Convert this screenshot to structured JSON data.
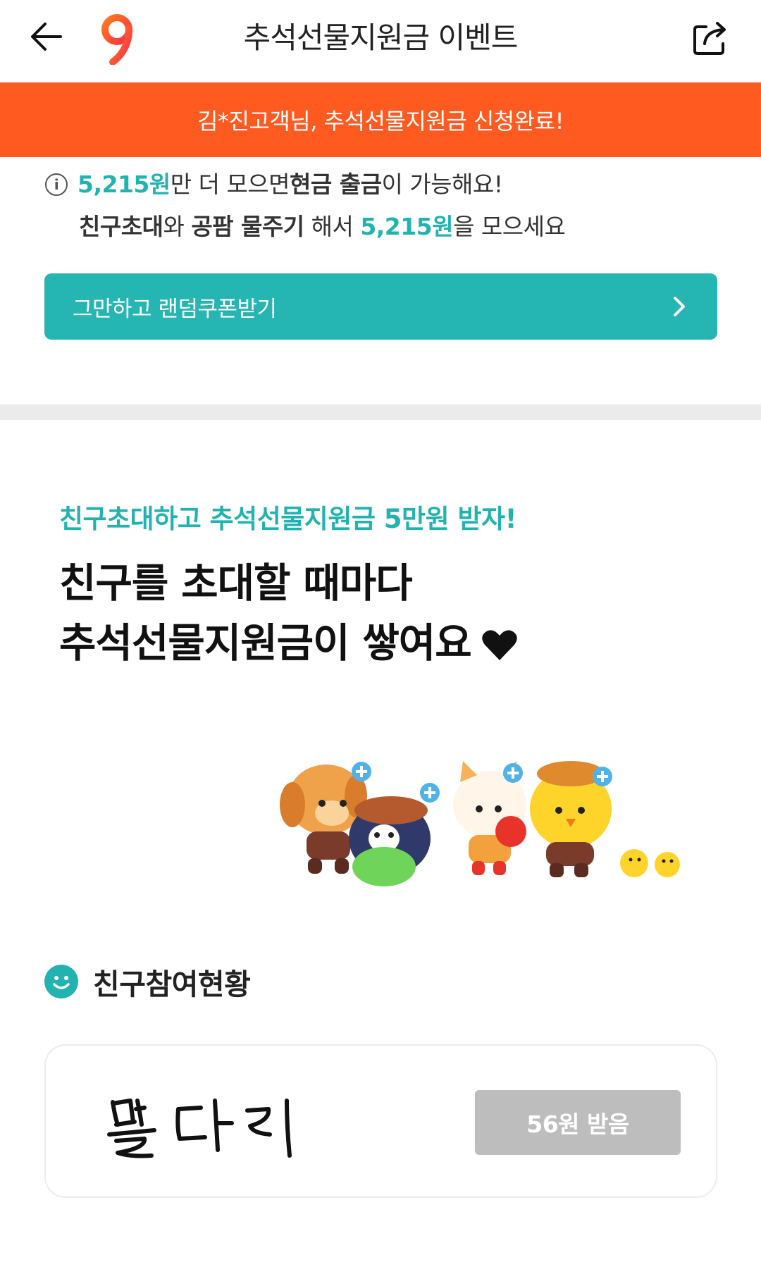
{
  "header": {
    "title": "추석선물지원금 이벤트"
  },
  "banner": {
    "text": "김*진고객님, 추석선물지원금 신청완료!"
  },
  "info": {
    "line1_amount": "5,215원",
    "line1_mid": "만 더 모으면 ",
    "line1_bold": "현금 출금",
    "line1_end": "이 가능해요!",
    "line2_bold1": "친구초대",
    "line2_mid1": "와 ",
    "line2_bold2": "공팜 물주기",
    "line2_mid2": " 해서 ",
    "line2_amount": "5,215원",
    "line2_end": "을 모으세요"
  },
  "cta": {
    "label": "그만하고 랜덤쿠폰받기"
  },
  "promo": {
    "subhead": "친구초대하고 추석선물지원금 5만원 받자!",
    "headline_line1": "친구를 초대할 때마다",
    "headline_line2": "추석선물지원금이 쌓여요"
  },
  "friends_status": {
    "title": "친구참여현황",
    "items": [
      {
        "name": "뿔다리",
        "status": "56원 받음"
      }
    ]
  },
  "colors": {
    "accent_teal": "#22b3b0",
    "banner_orange": "#ff5a1f",
    "disabled_gray": "#bdbdbd"
  },
  "icons": [
    "back-arrow-icon",
    "app-logo",
    "share-icon",
    "info-icon",
    "chevron-right-icon",
    "heart-icon",
    "smile-icon"
  ]
}
